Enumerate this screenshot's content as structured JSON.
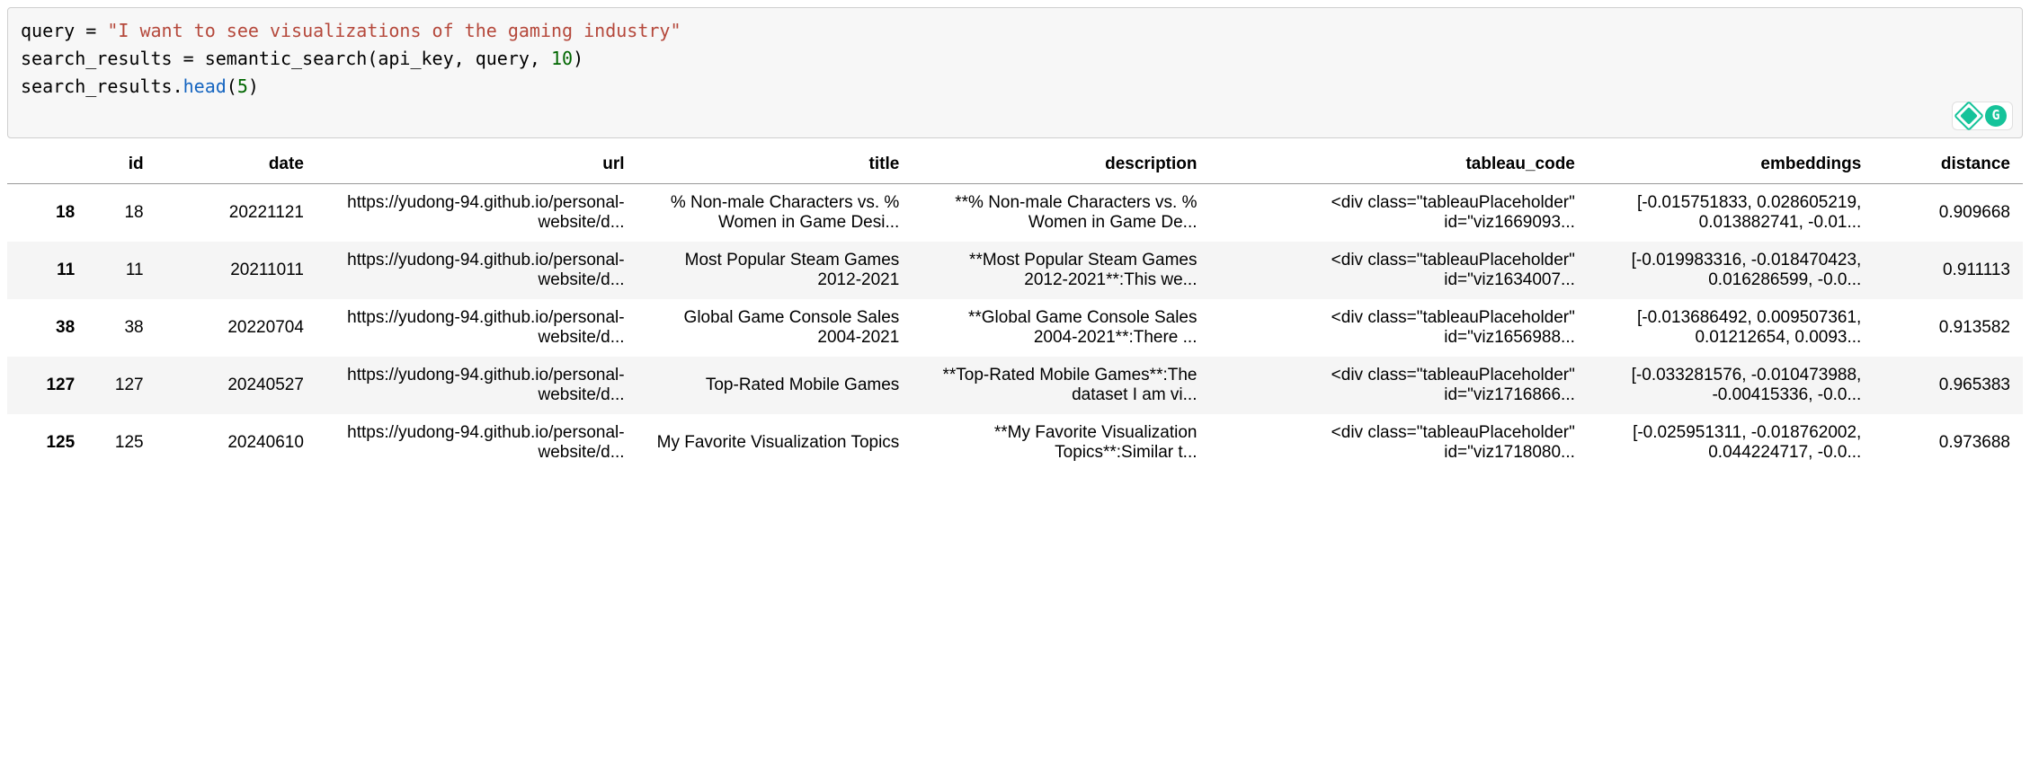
{
  "code": {
    "line1_pre": "query = ",
    "line1_str": "\"I want to see visualizations of the gaming industry\"",
    "line2_pre": "search_results = semantic_search(api_key, query, ",
    "line2_num": "10",
    "line2_post": ")",
    "line3_pre": "search_results.",
    "line3_method": "head",
    "line3_open": "(",
    "line3_num": "5",
    "line3_close": ")"
  },
  "icons": {
    "grammarly": "G",
    "diamond": "diamond-icon"
  },
  "table": {
    "columns": [
      "id",
      "date",
      "url",
      "title",
      "description",
      "tableau_code",
      "embeddings",
      "distance"
    ],
    "rows": [
      {
        "index": "18",
        "id": "18",
        "date": "20221121",
        "url": "https://yudong-94.github.io/personal-website/d...",
        "title": "% Non-male Characters vs. % Women in Game Desi...",
        "description": "**% Non-male Characters vs. % Women in Game De...",
        "tableau_code": "<div class=\"tableauPlaceholder\" id=\"viz1669093...",
        "embeddings": "[-0.015751833, 0.028605219, 0.013882741, -0.01...",
        "distance": "0.909668"
      },
      {
        "index": "11",
        "id": "11",
        "date": "20211011",
        "url": "https://yudong-94.github.io/personal-website/d...",
        "title": "Most Popular Steam Games 2012-2021",
        "description": "**Most Popular Steam Games 2012-2021**:This we...",
        "tableau_code": "<div class=\"tableauPlaceholder\" id=\"viz1634007...",
        "embeddings": "[-0.019983316, -0.018470423, 0.016286599, -0.0...",
        "distance": "0.911113"
      },
      {
        "index": "38",
        "id": "38",
        "date": "20220704",
        "url": "https://yudong-94.github.io/personal-website/d...",
        "title": "Global Game Console Sales 2004-2021",
        "description": "**Global Game Console Sales 2004-2021**:There ...",
        "tableau_code": "<div class=\"tableauPlaceholder\" id=\"viz1656988...",
        "embeddings": "[-0.013686492, 0.009507361, 0.01212654, 0.0093...",
        "distance": "0.913582"
      },
      {
        "index": "127",
        "id": "127",
        "date": "20240527",
        "url": "https://yudong-94.github.io/personal-website/d...",
        "title": "Top-Rated Mobile Games",
        "description": "**Top-Rated Mobile Games**:The dataset I am vi...",
        "tableau_code": "<div class=\"tableauPlaceholder\" id=\"viz1716866...",
        "embeddings": "[-0.033281576, -0.010473988, -0.00415336, -0.0...",
        "distance": "0.965383"
      },
      {
        "index": "125",
        "id": "125",
        "date": "20240610",
        "url": "https://yudong-94.github.io/personal-website/d...",
        "title": "My Favorite Visualization Topics",
        "description": "**My Favorite Visualization Topics**:Similar t...",
        "tableau_code": "<div class=\"tableauPlaceholder\" id=\"viz1718080...",
        "embeddings": "[-0.025951311, -0.018762002, 0.044224717, -0.0...",
        "distance": "0.973688"
      }
    ]
  }
}
